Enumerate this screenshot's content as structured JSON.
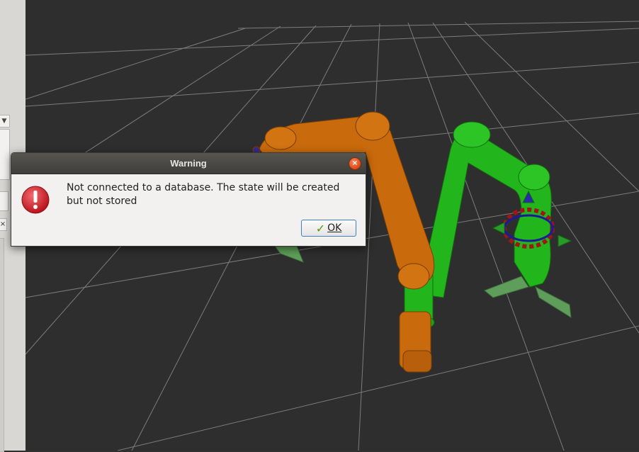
{
  "dialog": {
    "title": "Warning",
    "message": "Not connected to a database. The state will be created but not stored",
    "ok_label": "OK",
    "icon": "error-icon",
    "close_icon": "close-icon"
  },
  "left_panel": {
    "dropdown_icon": "chevron-down-icon",
    "close_icon": "close-icon"
  },
  "viewport": {
    "scene": "3d-robot-arm-scene",
    "colors": {
      "background": "#2e2e2e",
      "grid": "#8a8a8a",
      "arm_current": "#c96a0c",
      "arm_goal": "#1fb21a",
      "gripper": "#5e9e5a"
    }
  },
  "colors": {
    "titlebar": "#4a4945",
    "dialog_bg": "#f2f1f0",
    "close_button": "#dd4814",
    "error_icon": "#d3222a",
    "ok_focus_border": "#3e80c8"
  }
}
